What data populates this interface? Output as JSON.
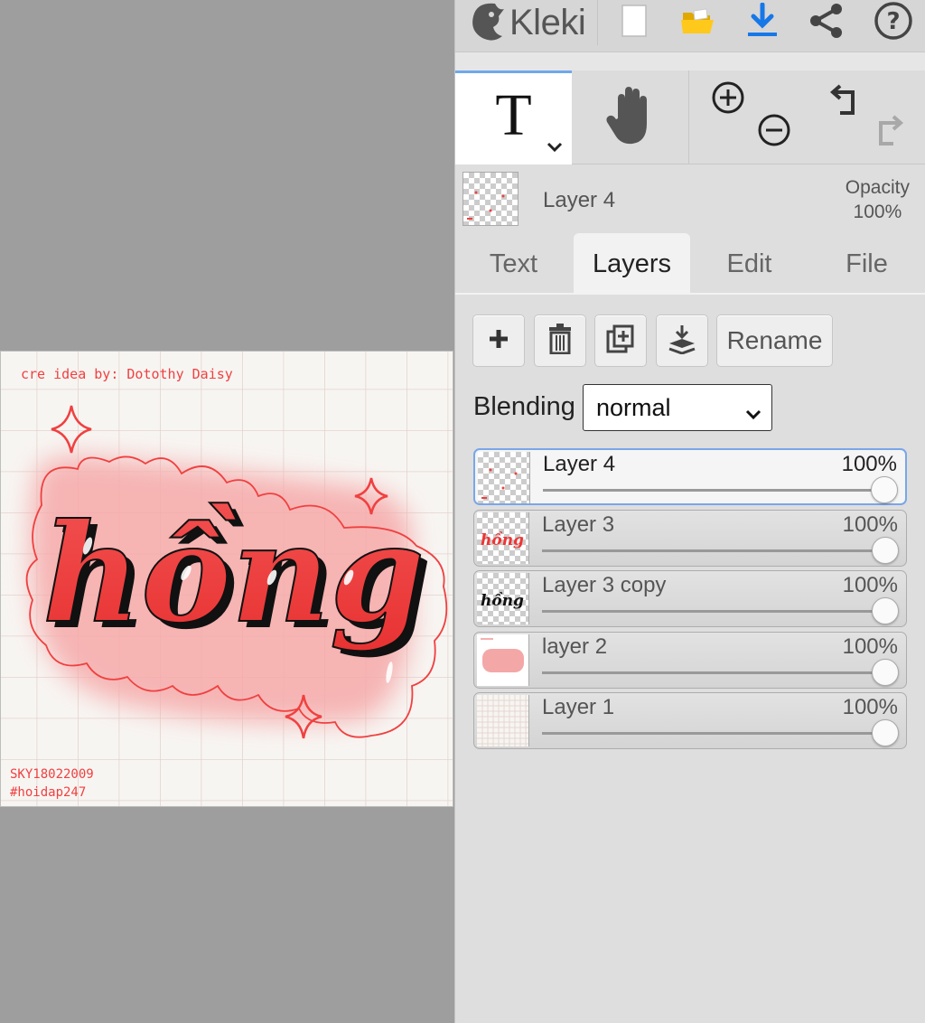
{
  "app": {
    "name": "Kleki"
  },
  "canvas": {
    "credit": "cre idea by: Dotothy Daisy",
    "word": "hồng",
    "signature_line1": "SKY18022009",
    "signature_line2": "#hoidap247",
    "accent_color": "#f23b3b"
  },
  "toolbar": {
    "icons": [
      "kleki-logo-icon",
      "new-file-icon",
      "open-folder-icon",
      "download-icon",
      "share-icon",
      "help-icon"
    ],
    "tool_text_glyph": "T",
    "tool_icons": [
      "text-tool-icon",
      "hand-tool-icon",
      "zoom-in-icon",
      "zoom-out-icon",
      "undo-icon",
      "redo-icon"
    ]
  },
  "active_layer": {
    "name": "Layer 4",
    "opacity_label": "Opacity",
    "opacity_value": "100%"
  },
  "tabs": [
    {
      "label": "Text",
      "active": false
    },
    {
      "label": "Layers",
      "active": true
    },
    {
      "label": "Edit",
      "active": false
    },
    {
      "label": "File",
      "active": false
    }
  ],
  "layers_panel": {
    "buttons": [
      "add-layer",
      "delete-layer",
      "duplicate-layer",
      "merge-down"
    ],
    "rename_label": "Rename",
    "blending_label": "Blending",
    "blending_value": "normal",
    "layers": [
      {
        "name": "Layer 4",
        "opacity": "100%",
        "selected": true
      },
      {
        "name": "Layer 3",
        "opacity": "100%",
        "selected": false
      },
      {
        "name": "Layer 3 copy",
        "opacity": "100%",
        "selected": false
      },
      {
        "name": "layer 2",
        "opacity": "100%",
        "selected": false
      },
      {
        "name": "Layer 1",
        "opacity": "100%",
        "selected": false
      }
    ]
  }
}
